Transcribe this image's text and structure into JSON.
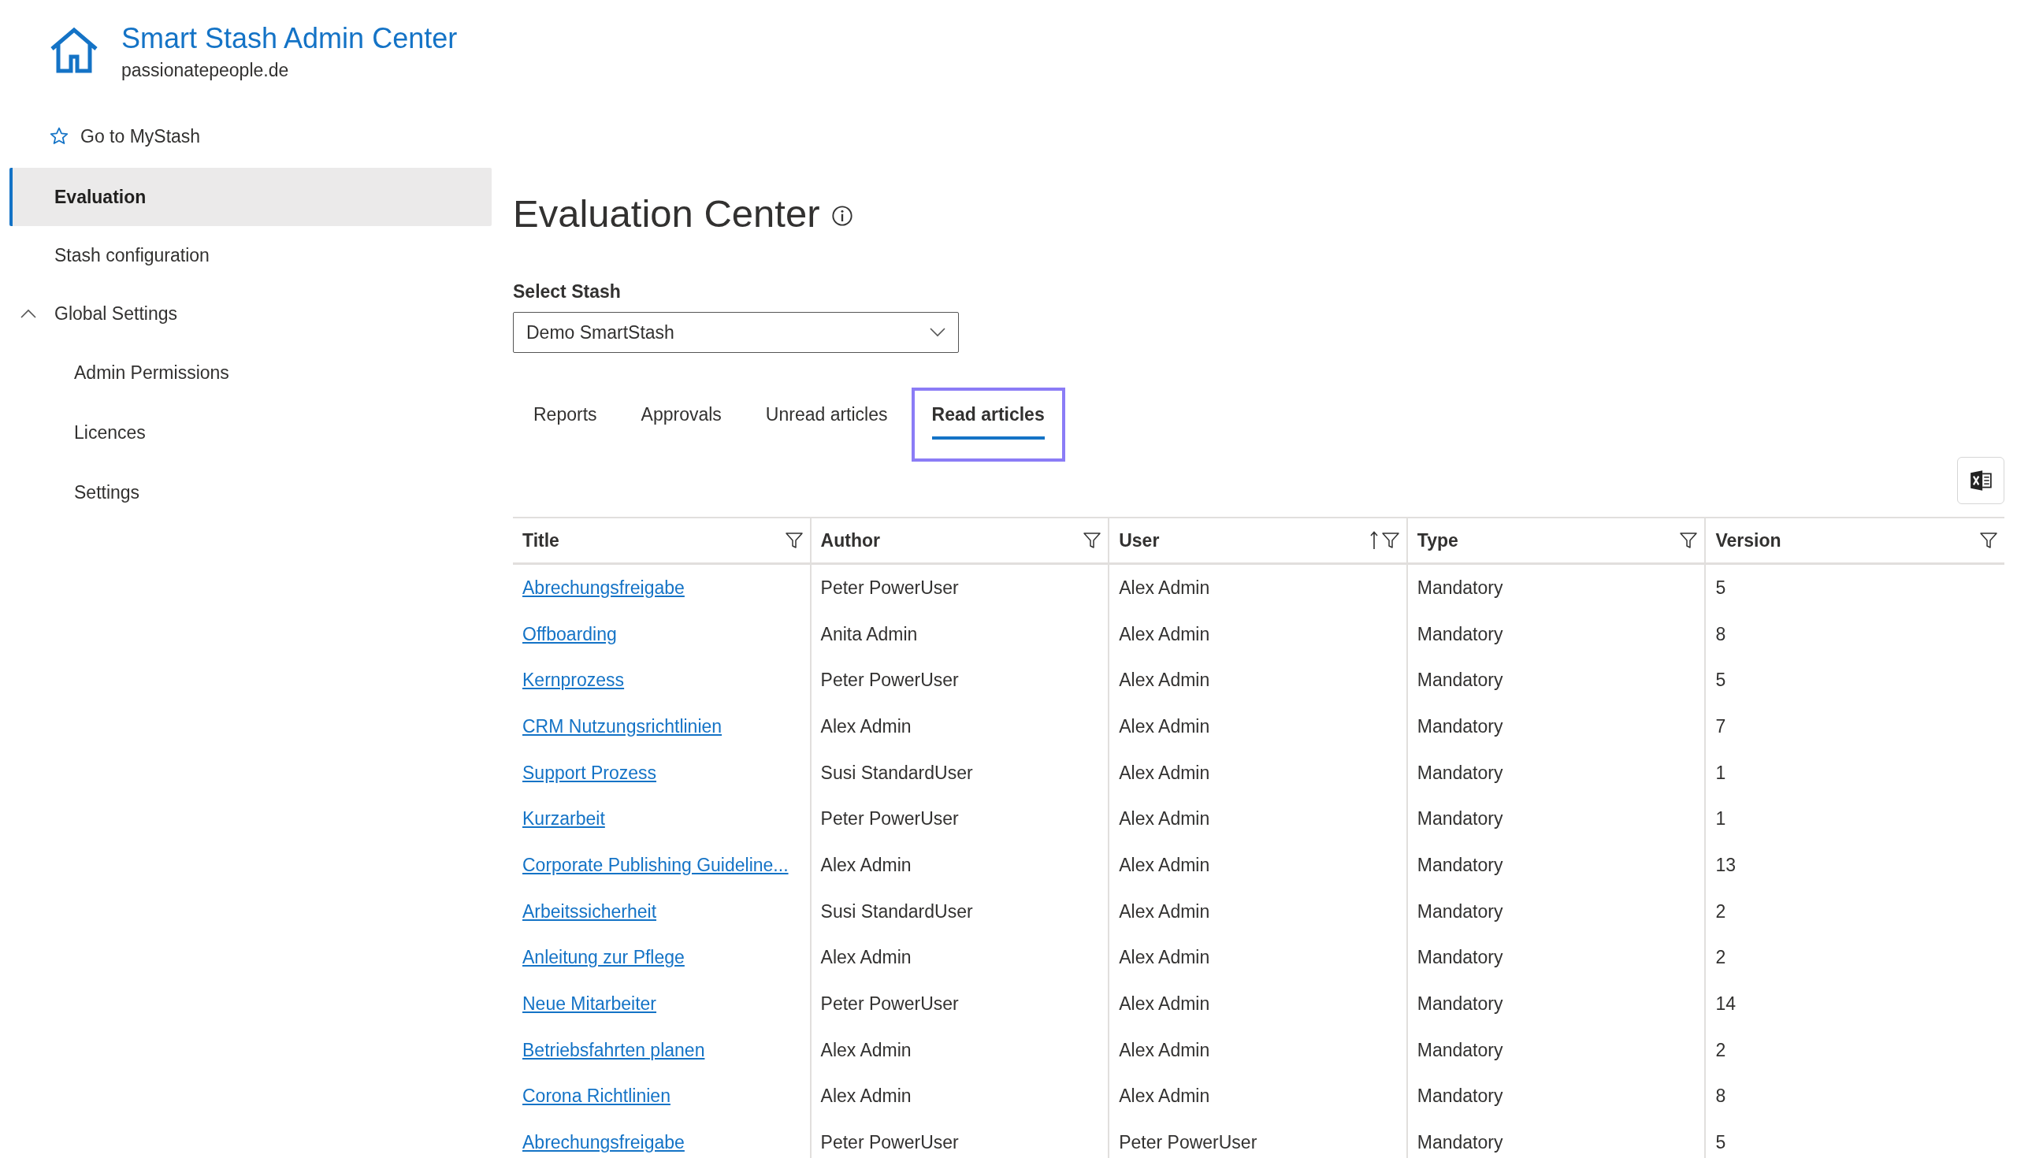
{
  "app": {
    "title": "Smart Stash Admin Center",
    "subtitle": "passionatepeople.de"
  },
  "sidebar": {
    "items": [
      {
        "kind": "link",
        "label": "Go to MyStash",
        "selected": false
      },
      {
        "kind": "item",
        "label": "Evaluation",
        "selected": true
      },
      {
        "kind": "item",
        "label": "Stash configuration",
        "selected": false
      },
      {
        "kind": "group",
        "label": "Global Settings",
        "selected": false,
        "expanded": true,
        "children": [
          {
            "label": "Admin Permissions",
            "selected": false
          },
          {
            "label": "Licences",
            "selected": false
          },
          {
            "label": "Settings",
            "selected": false
          }
        ]
      }
    ]
  },
  "page": {
    "title": "Evaluation Center"
  },
  "select_stash": {
    "label": "Select Stash",
    "value": "Demo SmartStash"
  },
  "tabs": [
    {
      "label": "Reports",
      "selected": false,
      "focused": false
    },
    {
      "label": "Approvals",
      "selected": false,
      "focused": false
    },
    {
      "label": "Unread articles",
      "selected": false,
      "focused": false
    },
    {
      "label": "Read articles",
      "selected": true,
      "focused": true
    }
  ],
  "table": {
    "columns": [
      {
        "label": "Title",
        "sorted": false
      },
      {
        "label": "Author",
        "sorted": false
      },
      {
        "label": "User",
        "sorted": true
      },
      {
        "label": "Type",
        "sorted": false
      },
      {
        "label": "Version",
        "sorted": false
      }
    ],
    "rows": [
      [
        "Abrechungsfreigabe",
        "Peter PowerUser",
        "Alex Admin",
        "Mandatory",
        "5"
      ],
      [
        "Offboarding",
        "Anita Admin",
        "Alex Admin",
        "Mandatory",
        "8"
      ],
      [
        "Kernprozess",
        "Peter PowerUser",
        "Alex Admin",
        "Mandatory",
        "5"
      ],
      [
        "CRM Nutzungsrichtlinien",
        "Alex Admin",
        "Alex Admin",
        "Mandatory",
        "7"
      ],
      [
        "Support Prozess",
        "Susi StandardUser",
        "Alex Admin",
        "Mandatory",
        "1"
      ],
      [
        "Kurzarbeit",
        "Peter PowerUser",
        "Alex Admin",
        "Mandatory",
        "1"
      ],
      [
        "Corporate Publishing Guideline...",
        "Alex Admin",
        "Alex Admin",
        "Mandatory",
        "13"
      ],
      [
        "Arbeitssicherheit",
        "Susi StandardUser",
        "Alex Admin",
        "Mandatory",
        "2"
      ],
      [
        "Anleitung zur Pflege",
        "Alex Admin",
        "Alex Admin",
        "Mandatory",
        "2"
      ],
      [
        "Neue Mitarbeiter",
        "Peter PowerUser",
        "Alex Admin",
        "Mandatory",
        "14"
      ],
      [
        "Betriebsfahrten planen",
        "Alex Admin",
        "Alex Admin",
        "Mandatory",
        "2"
      ],
      [
        "Corona Richtlinien",
        "Alex Admin",
        "Alex Admin",
        "Mandatory",
        "8"
      ],
      [
        "Abrechungsfreigabe",
        "Peter PowerUser",
        "Peter PowerUser",
        "Mandatory",
        "5"
      ]
    ]
  }
}
